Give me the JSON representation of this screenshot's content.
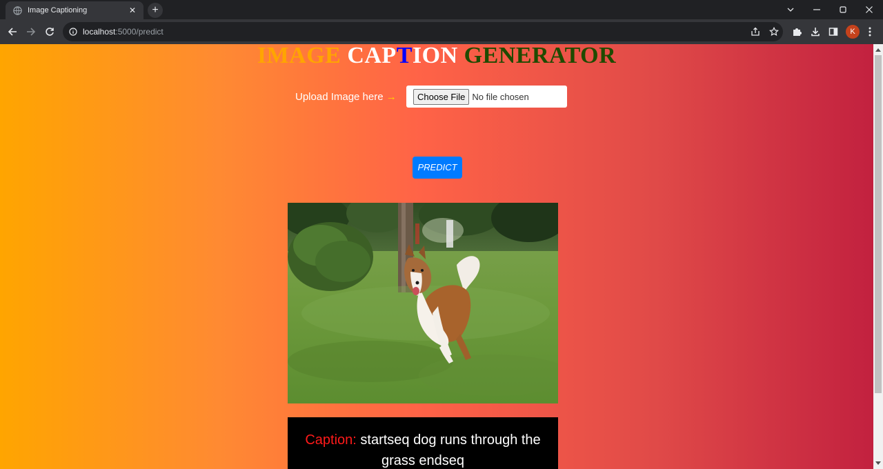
{
  "browser": {
    "tab_title": "Image Captioning",
    "new_tab": "+",
    "url_host": "localhost",
    "url_path": ":5000/predict",
    "profile_initial": "K"
  },
  "page": {
    "heading": {
      "word_image": "IMAGE",
      "word_cap": "CAP",
      "letter_t": "T",
      "word_ion": "ION",
      "word_generator": "GENERATOR"
    },
    "upload_label": "Upload Image here",
    "upload_arrow": "→",
    "file_button": "Choose File",
    "file_status": "No file chosen",
    "predict_button": "PREDICT",
    "caption_label": "Caption:",
    "caption_text": "startseq dog runs through the grass endseq"
  },
  "colors": {
    "gradient_start": "#ffa500",
    "gradient_mid": "#ff6347",
    "gradient_end": "#c2213f",
    "heading_image": "#ffa500",
    "heading_cap": "#ffffff",
    "heading_t": "#0000ff",
    "heading_generator": "#1f4a00",
    "predict_button": "#007bff",
    "caption_label": "#ff1a1a",
    "caption_bg": "#000000"
  },
  "icons": {
    "tab": "globe-icon",
    "back": "back-arrow-icon",
    "forward": "forward-arrow-icon",
    "reload": "reload-icon",
    "site_info": "info-icon",
    "share": "share-icon",
    "bookmark": "star-icon",
    "extensions": "puzzle-icon",
    "downloads": "download-icon",
    "side_panel": "side-panel-icon",
    "menu": "kebab-menu-icon"
  }
}
